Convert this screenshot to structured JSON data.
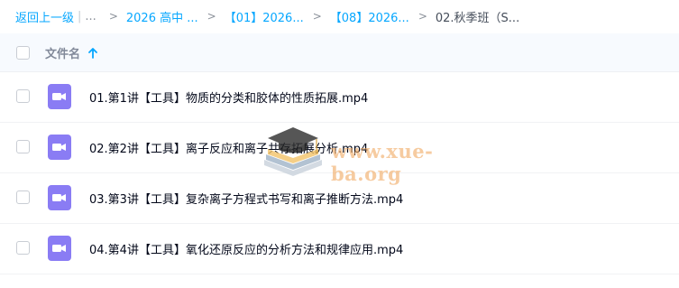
{
  "breadcrumb": {
    "back_label": "返回上一级",
    "separator_bar": "|",
    "ellipsis": "...",
    "items": [
      {
        "label": "2026 高中 ..."
      },
      {
        "label": "【01】2026..."
      },
      {
        "label": "【08】2026..."
      }
    ],
    "separator": ">",
    "current": "02.秋季班（S..."
  },
  "header": {
    "column_label": "文件名",
    "sort_icon": "arrow-up-icon"
  },
  "files": [
    {
      "name": "01.第1讲【工具】物质的分类和胶体的性质拓展.mp4",
      "icon": "video-file-icon"
    },
    {
      "name": "02.第2讲【工具】离子反应和离子共存拓展分析.mp4",
      "icon": "video-file-icon"
    },
    {
      "name": "03.第3讲【工具】复杂离子方程式书写和离子推断方法.mp4",
      "icon": "video-file-icon"
    },
    {
      "name": "04.第4讲【工具】氧化还原反应的分析方法和规律应用.mp4",
      "icon": "video-file-icon"
    }
  ],
  "watermark": {
    "text": "www.xue-ba.org",
    "icon": "graduation-cap-books-icon"
  },
  "colors": {
    "link": "#06a7ff",
    "header_bg": "#f7fafe",
    "video_icon": "#8a7cf4"
  }
}
